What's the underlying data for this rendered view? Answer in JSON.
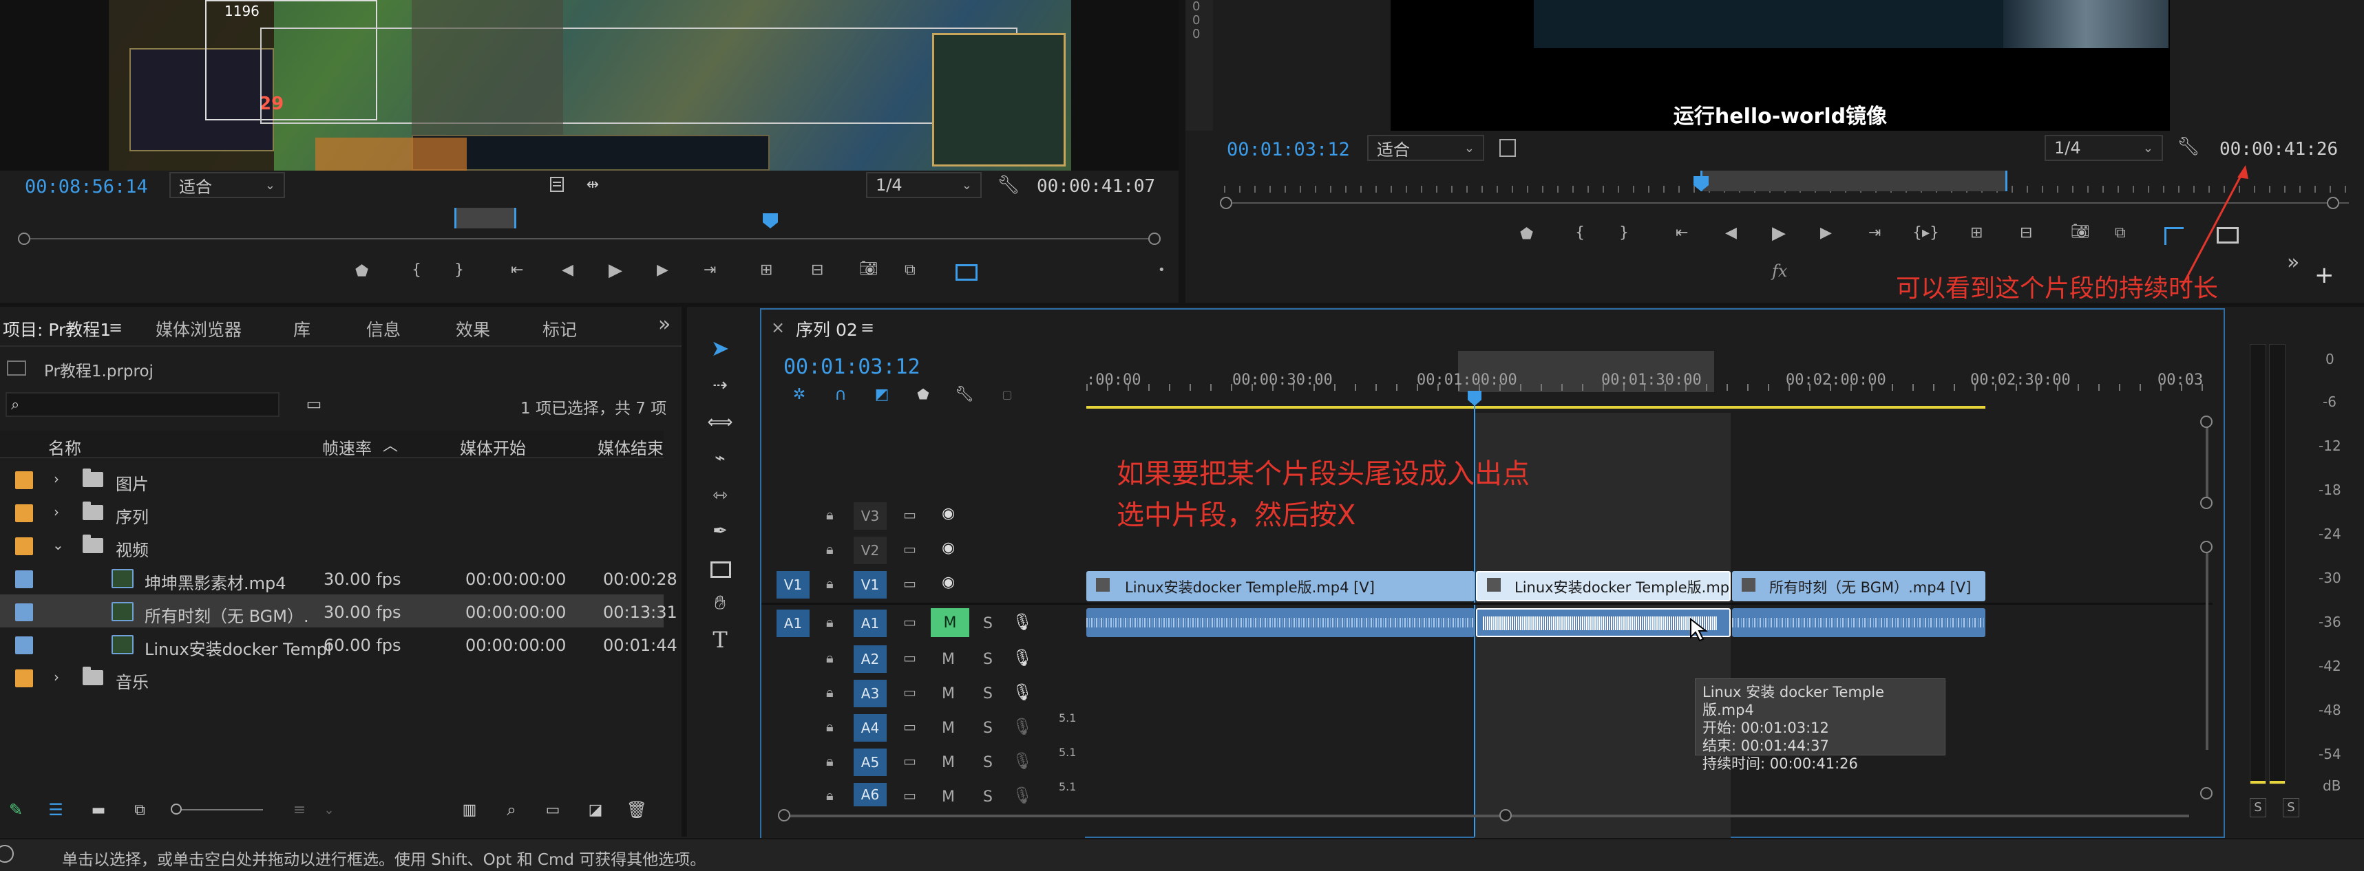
{
  "source_monitor": {
    "timecode": "00:08:56:14",
    "fit": "适合",
    "quality": "1/4",
    "duration": "00:00:41:07",
    "game_hud": {
      "number_a": "1196",
      "number_b": "29"
    }
  },
  "program_monitor": {
    "timecode": "00:01:03:12",
    "fit": "适合",
    "quality": "1/4",
    "duration": "00:00:41:26",
    "subtitle": "运行hello-world镜像",
    "fx_label": "fx",
    "annotation": "可以看到这个片段的持续时长",
    "overflow": "»",
    "plus": "+"
  },
  "project": {
    "tabs": [
      "项目: Pr教程1",
      "媒体浏览器",
      "库",
      "信息",
      "效果",
      "标记"
    ],
    "overflow": "»",
    "file": "Pr教程1.prproj",
    "selection_info": "1 项已选择，共 7 项",
    "columns": [
      "名称",
      "帧速率",
      "媒体开始",
      "媒体结束"
    ],
    "rows": [
      {
        "type": "folder",
        "name": "图片",
        "color": "#e8a03b",
        "fps": "",
        "start": "",
        "end": ""
      },
      {
        "type": "folder",
        "name": "序列",
        "color": "#e8a03b",
        "fps": "",
        "start": "",
        "end": ""
      },
      {
        "type": "folder",
        "name": "视频",
        "color": "#e8a03b",
        "fps": "",
        "start": "",
        "end": ""
      },
      {
        "type": "clip",
        "name": "坤坤黑影素材.mp4",
        "color": "#6fa0d6",
        "fps": "30.00 fps",
        "start": "00:00:00:00",
        "end": "00:00:28"
      },
      {
        "type": "clip",
        "name": "所有时刻（无 BGM）.",
        "color": "#6fa0d6",
        "fps": "30.00 fps",
        "start": "00:00:00:00",
        "end": "00:13:31"
      },
      {
        "type": "clip",
        "name": "Linux安装docker Templ",
        "color": "#6fa0d6",
        "fps": "60.00 fps",
        "start": "00:00:00:00",
        "end": "00:01:44"
      },
      {
        "type": "folder",
        "name": "音乐",
        "color": "#e8a03b",
        "fps": "",
        "start": "",
        "end": ""
      }
    ]
  },
  "timeline": {
    "close": "×",
    "sequence_name": "序列 02",
    "timecode": "00:01:03:12",
    "ruler": [
      ":00:00",
      "00:00:30:00",
      "00:01:00:00",
      "00:01:30:00",
      "00:02:00:00",
      "00:02:30:00",
      "00:03"
    ],
    "annotation_line1": "如果要把某个片段头尾设成入出点",
    "annotation_line2": "选中片段，然后按X",
    "tracks": {
      "v3": "V3",
      "v2": "V2",
      "v1_src": "V1",
      "v1": "V1",
      "a1_src": "A1",
      "a1": "A1",
      "a2": "A2",
      "a3": "A3",
      "a4": "A4",
      "a5": "A5",
      "a6": "A6",
      "m": "M",
      "s": "S",
      "level": "5.1"
    },
    "clips": {
      "v1_a": "Linux安装docker Temple版.mp4 [V]",
      "v1_b": "Linux安装docker Temple版.mp4 [V]",
      "v1_c": "所有时刻（无 BGM）.mp4 [V]"
    },
    "tooltip": {
      "name": "Linux 安装 docker Temple 版.mp4",
      "start": "开始: 00:01:03:12",
      "end": "结束: 00:01:44:37",
      "duration": "持续时间: 00:00:41:26"
    }
  },
  "meter": {
    "labels": [
      "0",
      "-6",
      "-12",
      "-18",
      "-24",
      "-30",
      "-36",
      "-42",
      "-48",
      "-54",
      "dB"
    ],
    "solo": "S"
  },
  "status_bar": {
    "text": "单击以选择，或单击空白处并拖动以进行框选。使用 Shift、Opt 和 Cmd 可获得其他选项。"
  },
  "colors": {
    "accent_blue": "#3c9ce8",
    "annotation_red": "#e2352b",
    "video_clip": "#8fb8e3",
    "audio_clip": "#4e7fb7",
    "folder_orange": "#e8a03b",
    "mute_green": "#4fc77a"
  }
}
